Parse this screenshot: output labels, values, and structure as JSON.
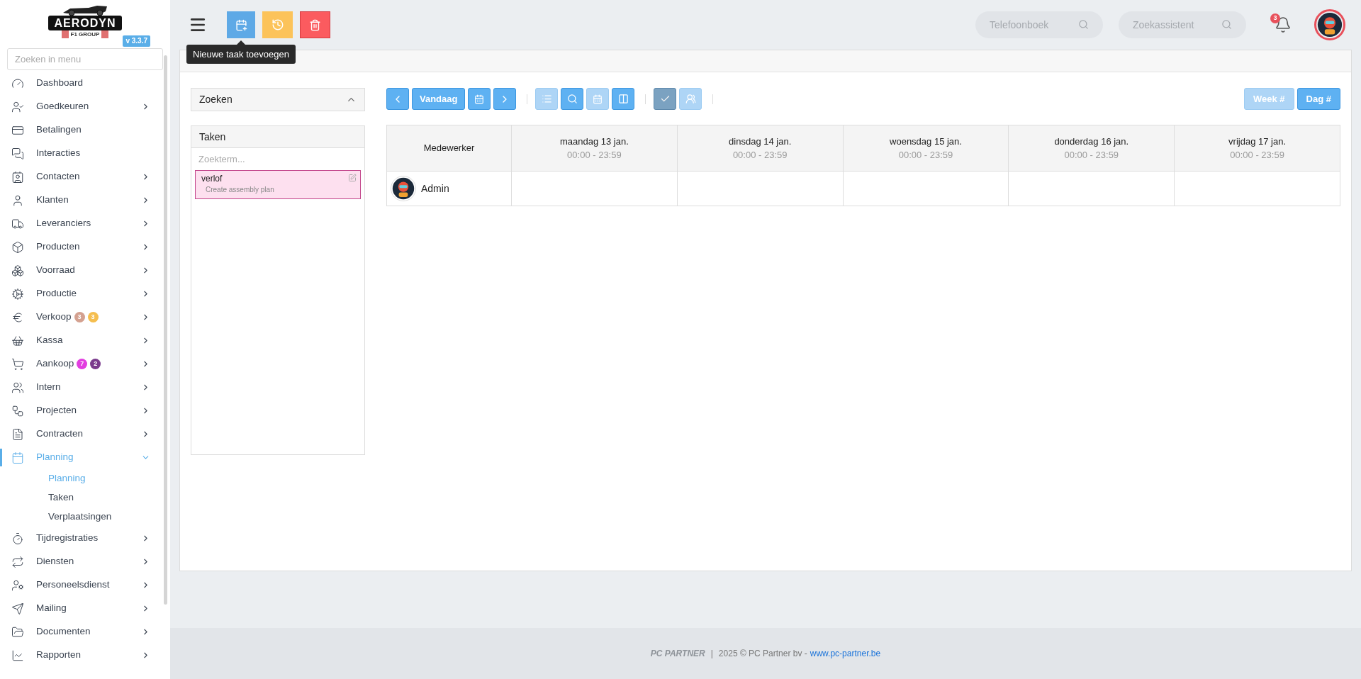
{
  "logo": {
    "name": "AERODYN",
    "tagline": "F1 GROUP"
  },
  "version": "v 3.3.7",
  "menu_search": {
    "placeholder": "Zoeken in menu"
  },
  "menu": [
    {
      "label": "Dashboard",
      "has_children": false,
      "selected": false
    },
    {
      "label": "Goedkeuren",
      "has_children": true,
      "expanded": false,
      "selected": false
    },
    {
      "label": "Betalingen",
      "has_children": false,
      "selected": false
    },
    {
      "label": "Interacties",
      "has_children": false,
      "selected": false
    },
    {
      "label": "Contacten",
      "has_children": true,
      "expanded": false,
      "selected": false
    },
    {
      "label": "Klanten",
      "has_children": true,
      "expanded": false,
      "selected": false
    },
    {
      "label": "Leveranciers",
      "has_children": true,
      "expanded": false,
      "selected": false
    },
    {
      "label": "Producten",
      "has_children": true,
      "expanded": false,
      "selected": false
    },
    {
      "label": "Voorraad",
      "has_children": true,
      "expanded": false,
      "selected": false
    },
    {
      "label": "Productie",
      "has_children": true,
      "expanded": false,
      "selected": false
    },
    {
      "label": "Verkoop",
      "has_children": true,
      "expanded": false,
      "selected": false,
      "badges": [
        {
          "text": "3",
          "color": "#d4a190"
        },
        {
          "text": "3",
          "color": "#f5be4f"
        }
      ]
    },
    {
      "label": "Kassa",
      "has_children": true,
      "expanded": false,
      "selected": false
    },
    {
      "label": "Aankoop",
      "has_children": true,
      "expanded": false,
      "selected": false,
      "badges": [
        {
          "text": "7",
          "color": "#e23ee0"
        },
        {
          "text": "2",
          "color": "#7a3a8c"
        }
      ]
    },
    {
      "label": "Intern",
      "has_children": true,
      "expanded": false,
      "selected": false
    },
    {
      "label": "Projecten",
      "has_children": true,
      "expanded": false,
      "selected": false
    },
    {
      "label": "Contracten",
      "has_children": true,
      "expanded": false,
      "selected": false
    },
    {
      "label": "Planning",
      "has_children": true,
      "expanded": true,
      "selected": true,
      "children": [
        {
          "label": "Planning",
          "selected": true
        },
        {
          "label": "Taken",
          "selected": false
        },
        {
          "label": "Verplaatsingen",
          "selected": false
        }
      ]
    },
    {
      "label": "Tijdregistraties",
      "has_children": true,
      "expanded": false,
      "selected": false
    },
    {
      "label": "Diensten",
      "has_children": true,
      "expanded": false,
      "selected": false
    },
    {
      "label": "Personeelsdienst",
      "has_children": true,
      "expanded": false,
      "selected": false
    },
    {
      "label": "Mailing",
      "has_children": true,
      "expanded": false,
      "selected": false
    },
    {
      "label": "Documenten",
      "has_children": true,
      "expanded": false,
      "selected": false
    },
    {
      "label": "Rapporten",
      "has_children": true,
      "expanded": false,
      "selected": false
    }
  ],
  "topbar": {
    "tooltip": "Nieuwe taak toevoegen",
    "phonebook": {
      "placeholder": "Telefoonboek"
    },
    "search_assistant": {
      "placeholder": "Zoekassistent"
    },
    "notifications": "3"
  },
  "search_panel": {
    "title": "Zoeken",
    "expanded": true
  },
  "tasks_panel": {
    "title": "Taken",
    "search": {
      "placeholder": "Zoekterm..."
    },
    "tasks": [
      {
        "title": "verlof",
        "subtitle": "Create assembly plan",
        "color": "#c2448a"
      }
    ]
  },
  "toolbar": {
    "buttons": [
      {
        "kind": "prev",
        "disabled": false,
        "active": false
      },
      {
        "kind": "today",
        "label": "Vandaag",
        "disabled": false,
        "active": false
      },
      {
        "kind": "calendar",
        "disabled": false,
        "active": false
      },
      {
        "kind": "next",
        "disabled": false,
        "active": false
      },
      {
        "kind": "sep"
      },
      {
        "kind": "list",
        "disabled": true,
        "active": false
      },
      {
        "kind": "search",
        "disabled": false,
        "active": false
      },
      {
        "kind": "calendar",
        "disabled": true,
        "active": false
      },
      {
        "kind": "columns",
        "disabled": false,
        "active": false
      },
      {
        "kind": "sep"
      },
      {
        "kind": "check",
        "disabled": false,
        "active": true
      },
      {
        "kind": "team",
        "disabled": true,
        "active": false
      },
      {
        "kind": "sep"
      }
    ],
    "views": [
      {
        "label": "Week #",
        "selected": false
      },
      {
        "label": "Dag #",
        "selected": true
      }
    ]
  },
  "calendar": {
    "columns": [
      {
        "day": "Medewerker"
      },
      {
        "day": "maandag 13 jan.",
        "hours": "00:00 - 23:59"
      },
      {
        "day": "dinsdag 14 jan.",
        "hours": "00:00 - 23:59"
      },
      {
        "day": "woensdag 15 jan.",
        "hours": "00:00 - 23:59"
      },
      {
        "day": "donderdag 16 jan.",
        "hours": "00:00 - 23:59"
      },
      {
        "day": "vrijdag 17 jan.",
        "hours": "00:00 - 23:59"
      }
    ],
    "rows": [
      {
        "name": "Admin"
      }
    ]
  },
  "footer": {
    "brand": "PC PARTNER",
    "separator": "|",
    "copyright": "2025 © PC Partner bv -",
    "link": "www.pc-partner.be"
  }
}
